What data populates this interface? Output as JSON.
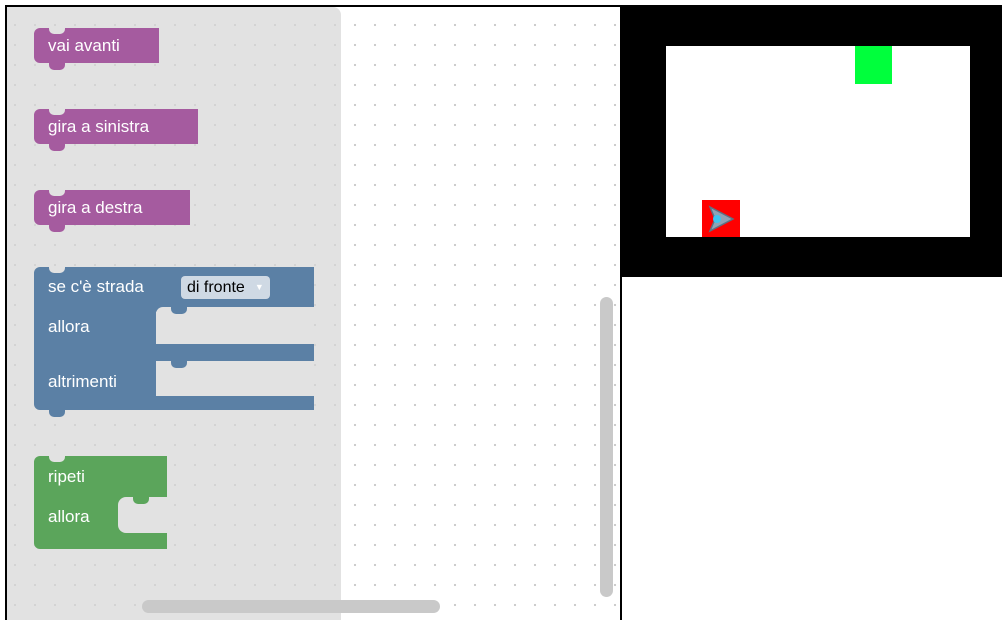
{
  "blocks": {
    "move_forward": "vai avanti",
    "turn_left": "gira a sinistra",
    "turn_right": "gira a destra",
    "if_path": {
      "label": "se c'è strada",
      "dropdown_value": "di fronte",
      "then_label": "allora",
      "else_label": "altrimenti"
    },
    "repeat": {
      "label": "ripeti",
      "do_label": "allora"
    }
  },
  "colors": {
    "motion_block": "#a55b9f",
    "logic_block": "#5b80a5",
    "loop_block": "#5ba55b",
    "goal": "#00ff3c",
    "player_tile": "#ff0000",
    "maze_wall": "#000000"
  },
  "game": {
    "player_icon": "arrow-right-icon"
  }
}
